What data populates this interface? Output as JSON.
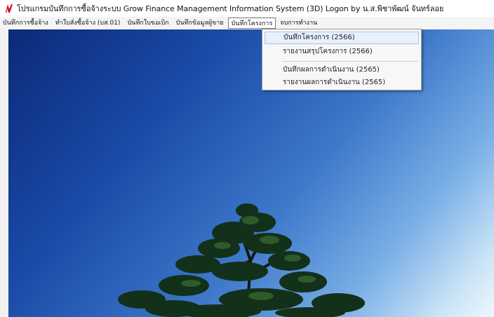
{
  "titlebar": {
    "title": "โปรแกรมบันทึกการซื้อจ้างระบบ  Grow Finance Management Information System (3D) Logon by น.ส.พิชาพัฒน์  จันทร์ลอย"
  },
  "menubar": {
    "items": [
      {
        "label": "บันทึกการซื้อจ้าง"
      },
      {
        "label": "ทำใบสั่งซื้อจ้าง (บส.01)"
      },
      {
        "label": "บันทึกใบขอเบิก"
      },
      {
        "label": "บันทึกข้อมูลผู้ขาย"
      },
      {
        "label": "บันทึกโครงการ"
      },
      {
        "label": "จบการทำงาน"
      }
    ]
  },
  "dropdown": {
    "items": [
      {
        "label": "บันทึกโครงการ (2566)"
      },
      {
        "label": "รายงานสรุปโครงการ (2566)"
      },
      {
        "label": "บันทึกผลการดำเนินงาน (2565)"
      },
      {
        "label": "รายงานผลการดำเนินงาน (2565)"
      }
    ]
  },
  "colors": {
    "app_logo": "#e0001b",
    "menu_highlight": "#e8f0fb",
    "sky_dark": "#0b2a78",
    "sky_light": "#eef7fd"
  },
  "desktop": {
    "wallpaper": "blue sky with tree top"
  }
}
